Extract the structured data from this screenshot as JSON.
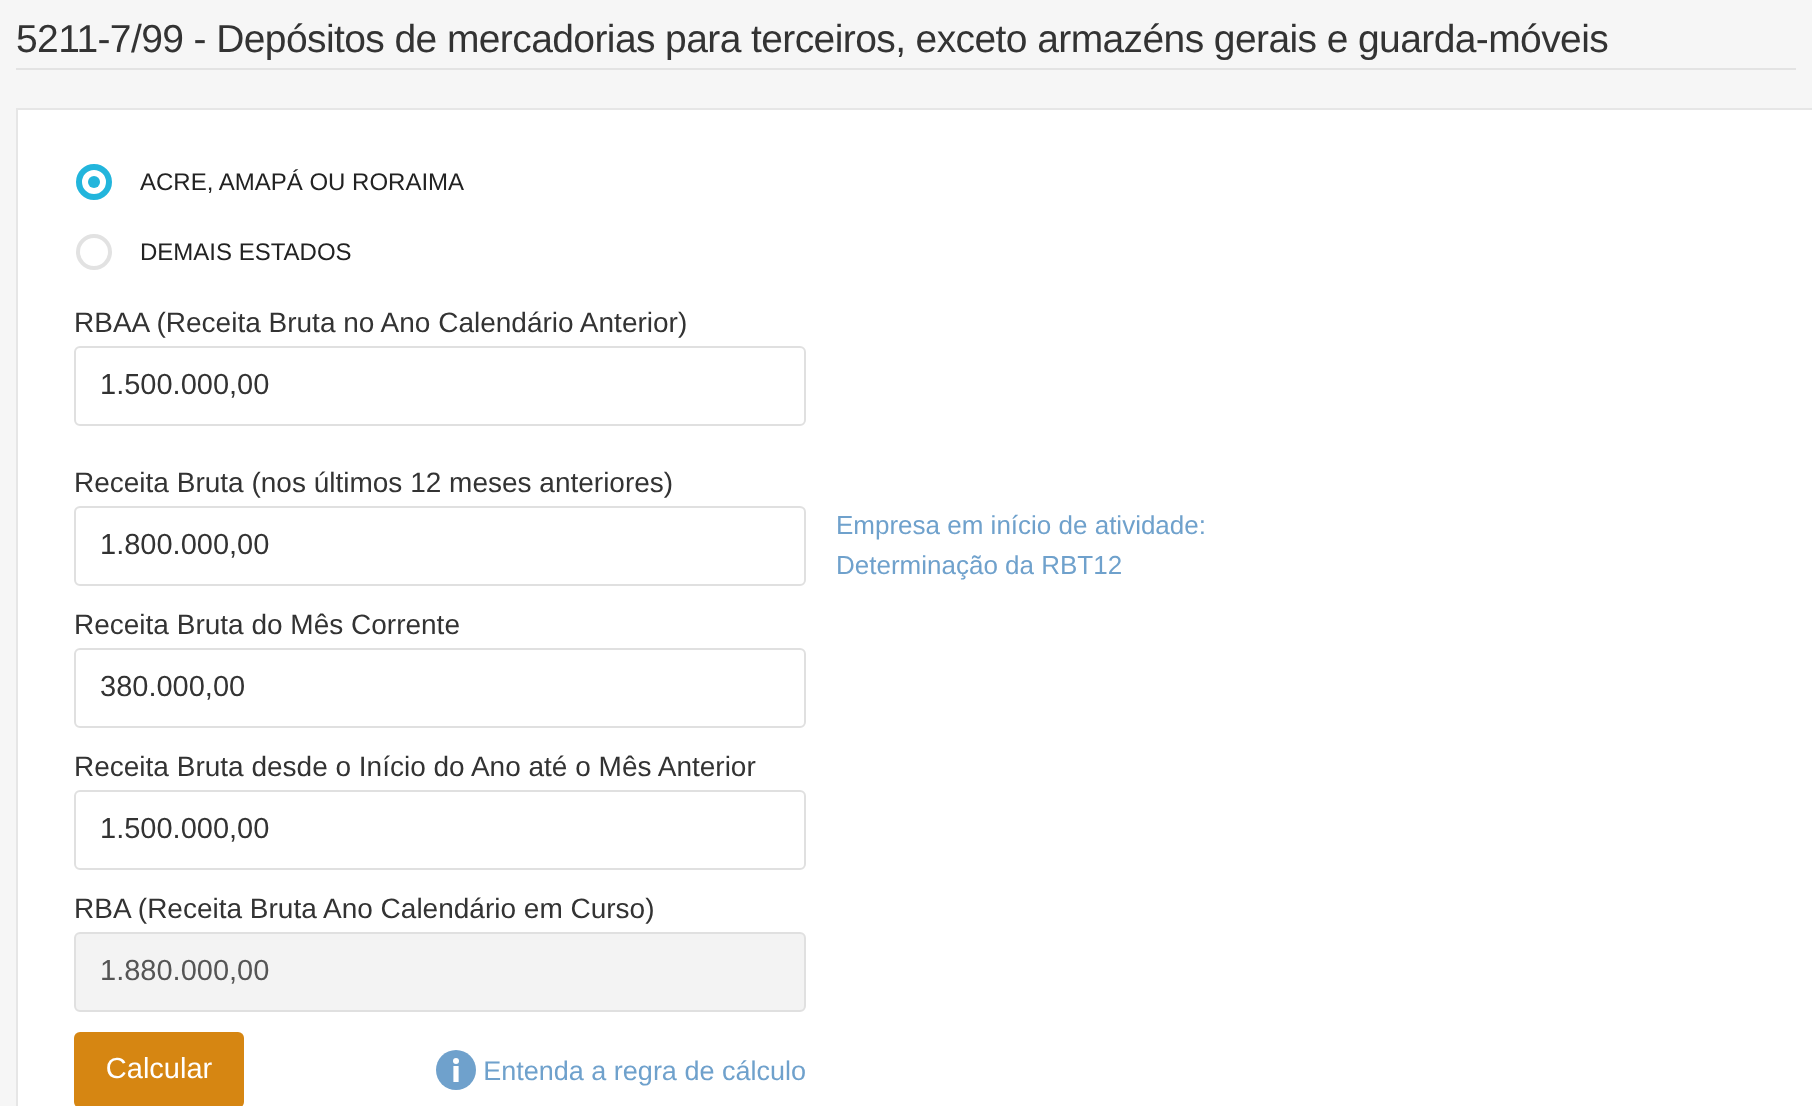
{
  "title": "5211-7/99 - Depósitos de mercadorias para terceiros, exceto armazéns gerais e guarda-móveis",
  "regions": [
    {
      "label": "ACRE, AMAPÁ OU RORAIMA",
      "selected": true
    },
    {
      "label": "DEMAIS ESTADOS",
      "selected": false
    }
  ],
  "fields": [
    {
      "label": "RBAA (Receita Bruta no Ano Calendário Anterior)",
      "value": "1.500.000,00",
      "disabled": false
    },
    {
      "label": "Receita Bruta (nos últimos 12 meses anteriores)",
      "value": "1.800.000,00",
      "disabled": false,
      "aside_link": [
        "Empresa em início de atividade:",
        "Determinação da RBT12"
      ]
    },
    {
      "label": "Receita Bruta do Mês Corrente",
      "value": "380.000,00",
      "disabled": false
    },
    {
      "label": "Receita Bruta desde o Início do Ano até o Mês Anterior",
      "value": "1.500.000,00",
      "disabled": false
    },
    {
      "label": "RBA (Receita Bruta Ano Calendário em Curso)",
      "value": "1.880.000,00",
      "disabled": true
    }
  ],
  "button": "Calcular",
  "help_link": "Entenda a regra de cálculo"
}
